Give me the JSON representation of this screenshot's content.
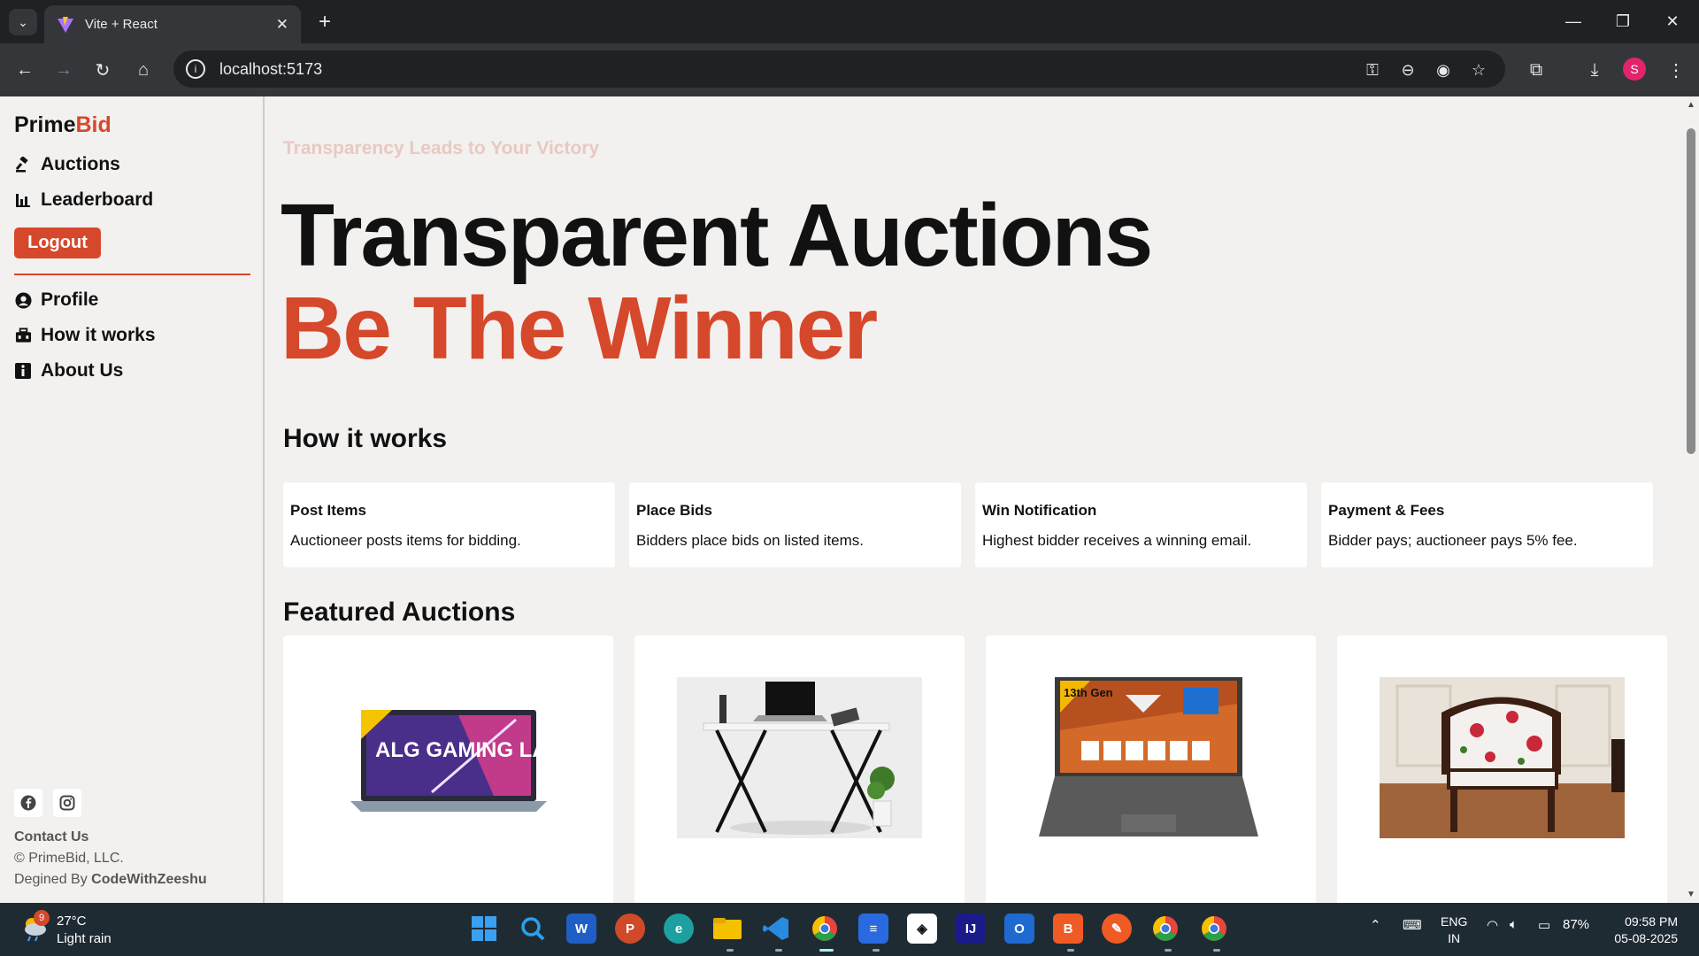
{
  "browser": {
    "tab_title": "Vite + React",
    "url": "localhost:5173",
    "profile_initial": "S"
  },
  "sidebar": {
    "brand_main": "Prime",
    "brand_accent": "Bid",
    "nav": [
      {
        "label": "Auctions",
        "icon": "gavel-icon"
      },
      {
        "label": "Leaderboard",
        "icon": "bar-chart-icon"
      }
    ],
    "logout_label": "Logout",
    "secondary_nav": [
      {
        "label": "Profile",
        "icon": "user-circle-icon"
      },
      {
        "label": "How it works",
        "icon": "toolbox-icon"
      },
      {
        "label": "About Us",
        "icon": "info-icon"
      }
    ],
    "contact_label": "Contact Us",
    "copyright": "© PrimeBid, LLC.",
    "designed_by_prefix": "Degined By ",
    "designed_by_name": "CodeWithZeeshu"
  },
  "main": {
    "tagline": "Transparency Leads to Your Victory",
    "hero_line1": "Transparent Auctions",
    "hero_line2": "Be The Winner",
    "how_title": "How it works",
    "steps": [
      {
        "title": "Post Items",
        "desc": "Auctioneer posts items for bidding."
      },
      {
        "title": "Place Bids",
        "desc": "Bidders place bids on listed items."
      },
      {
        "title": "Win Notification",
        "desc": "Highest bidder receives a winning email."
      },
      {
        "title": "Payment & Fees",
        "desc": "Bidder pays; auctioneer pays 5% fee."
      }
    ],
    "featured_title": "Featured Auctions",
    "featured_items": [
      {
        "image": "gaming-laptop-image",
        "badge": "ALG GAMING LAPTOP"
      },
      {
        "image": "study-table-image"
      },
      {
        "image": "victus-laptop-image",
        "badge": "13th Gen"
      },
      {
        "image": "floral-chair-image"
      }
    ]
  },
  "taskbar": {
    "weather_alert_count": "9",
    "temperature": "27°C",
    "weather": "Light rain",
    "lang_line1": "ENG",
    "lang_line2": "IN",
    "battery": "87%",
    "time": "09:58 PM",
    "date": "05-08-2025"
  },
  "colors": {
    "accent": "#d6482b",
    "background": "#f3f1ef",
    "browser_dark": "#202124",
    "taskbar": "#1f2b33"
  }
}
